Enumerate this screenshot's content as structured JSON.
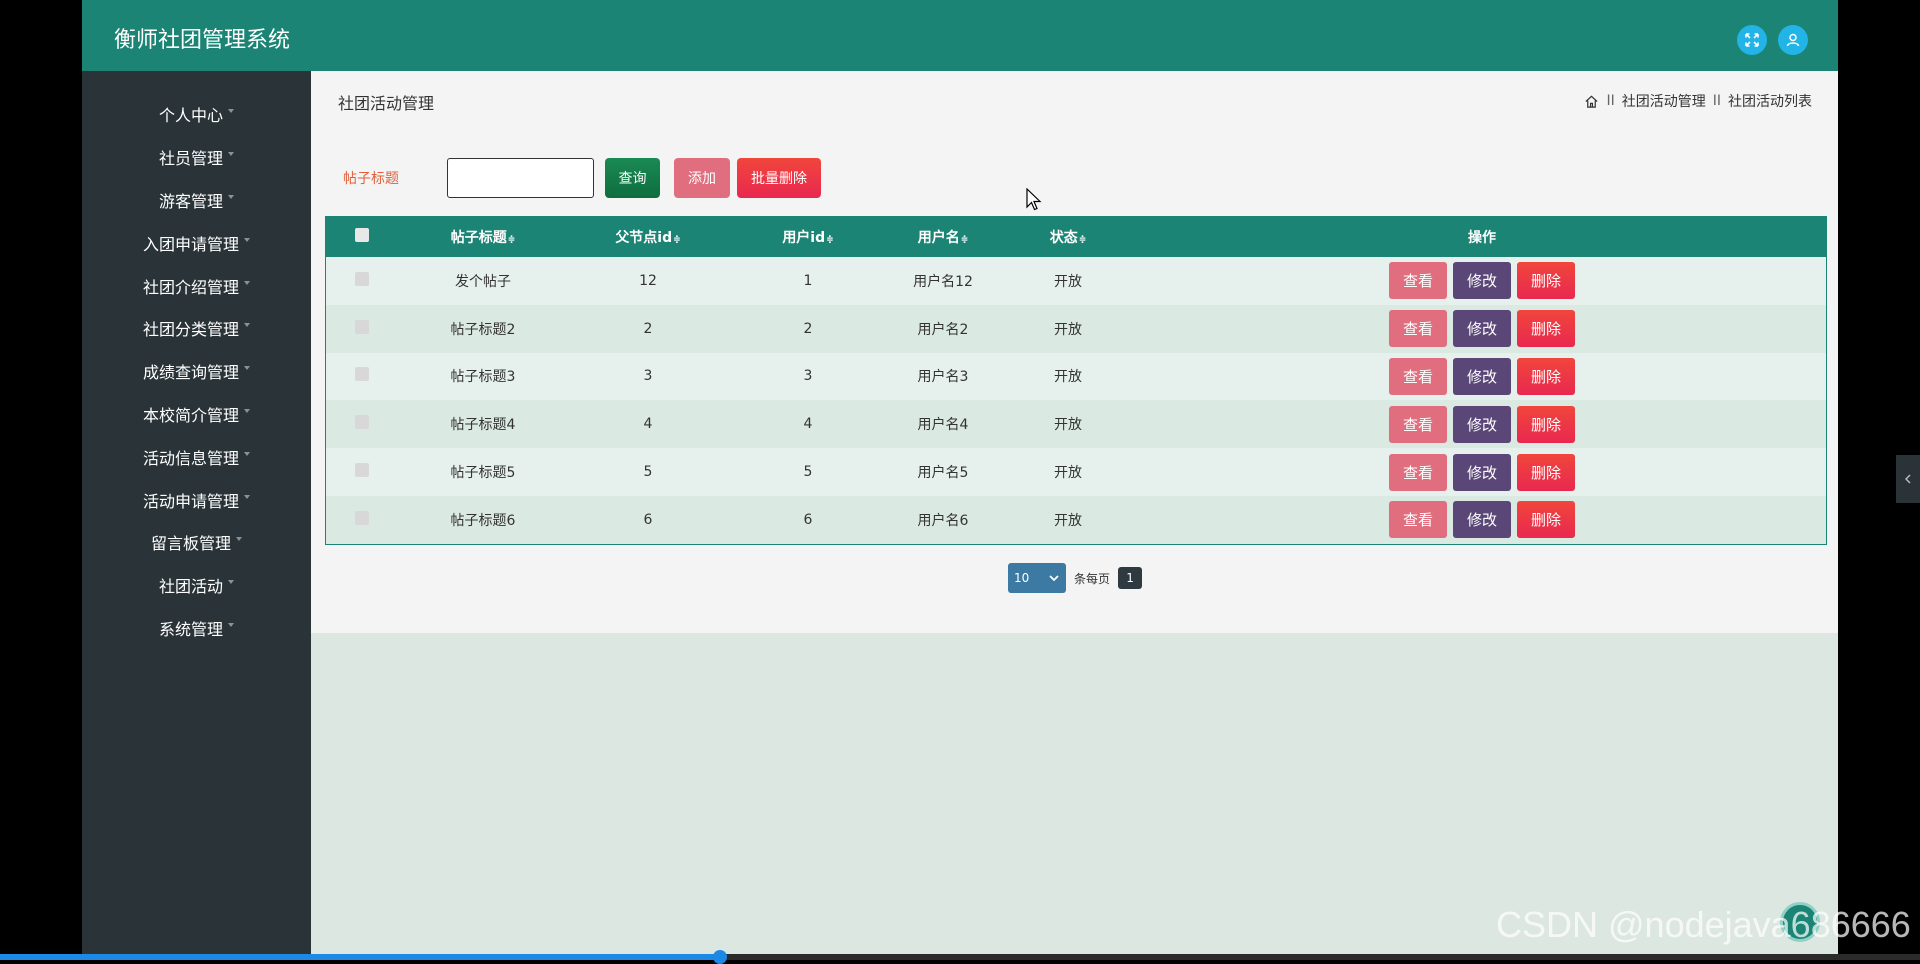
{
  "app": {
    "title": "衡师社团管理系统"
  },
  "sidebar": {
    "items": [
      {
        "label": "个人中心"
      },
      {
        "label": "社员管理"
      },
      {
        "label": "游客管理"
      },
      {
        "label": "入团申请管理"
      },
      {
        "label": "社团介绍管理"
      },
      {
        "label": "社团分类管理"
      },
      {
        "label": "成绩查询管理"
      },
      {
        "label": "本校简介管理"
      },
      {
        "label": "活动信息管理"
      },
      {
        "label": "活动申请管理"
      },
      {
        "label": "留言板管理"
      },
      {
        "label": "社团活动"
      },
      {
        "label": "系统管理"
      }
    ]
  },
  "page": {
    "title": "社团活动管理",
    "breadcrumb": {
      "items": [
        "社团活动管理",
        "社团活动列表"
      ],
      "separator": "II"
    }
  },
  "search": {
    "label": "帖子标题",
    "value": "",
    "query_label": "查询",
    "add_label": "添加",
    "batch_delete_label": "批量删除"
  },
  "table": {
    "columns": [
      "帖子标题",
      "父节点id",
      "用户id",
      "用户名",
      "状态",
      "操作"
    ],
    "sort_icon": "≑",
    "actions": {
      "view": "查看",
      "edit": "修改",
      "delete": "删除"
    },
    "rows": [
      {
        "title": "发个帖子",
        "parent_id": "12",
        "user_id": "1",
        "username": "用户名12",
        "status": "开放"
      },
      {
        "title": "帖子标题2",
        "parent_id": "2",
        "user_id": "2",
        "username": "用户名2",
        "status": "开放"
      },
      {
        "title": "帖子标题3",
        "parent_id": "3",
        "user_id": "3",
        "username": "用户名3",
        "status": "开放"
      },
      {
        "title": "帖子标题4",
        "parent_id": "4",
        "user_id": "4",
        "username": "用户名4",
        "status": "开放"
      },
      {
        "title": "帖子标题5",
        "parent_id": "5",
        "user_id": "5",
        "username": "用户名5",
        "status": "开放"
      },
      {
        "title": "帖子标题6",
        "parent_id": "6",
        "user_id": "6",
        "username": "用户名6",
        "status": "开放"
      }
    ]
  },
  "pager": {
    "page_size": "10",
    "per_page_label": "条每页",
    "current_page": "1"
  },
  "watermark": "CSDN @nodejava686666",
  "video_progress": 0.375,
  "colors": {
    "header": "#1b8474",
    "sidebar": "#2a3338",
    "delete": "#e9284f",
    "edit": "#5a4777",
    "view": "#e06e7e",
    "query": "#0e6d3e"
  },
  "icons": {
    "fullscreen": "fullscreen-icon",
    "user": "user-icon",
    "home": "home-icon"
  }
}
